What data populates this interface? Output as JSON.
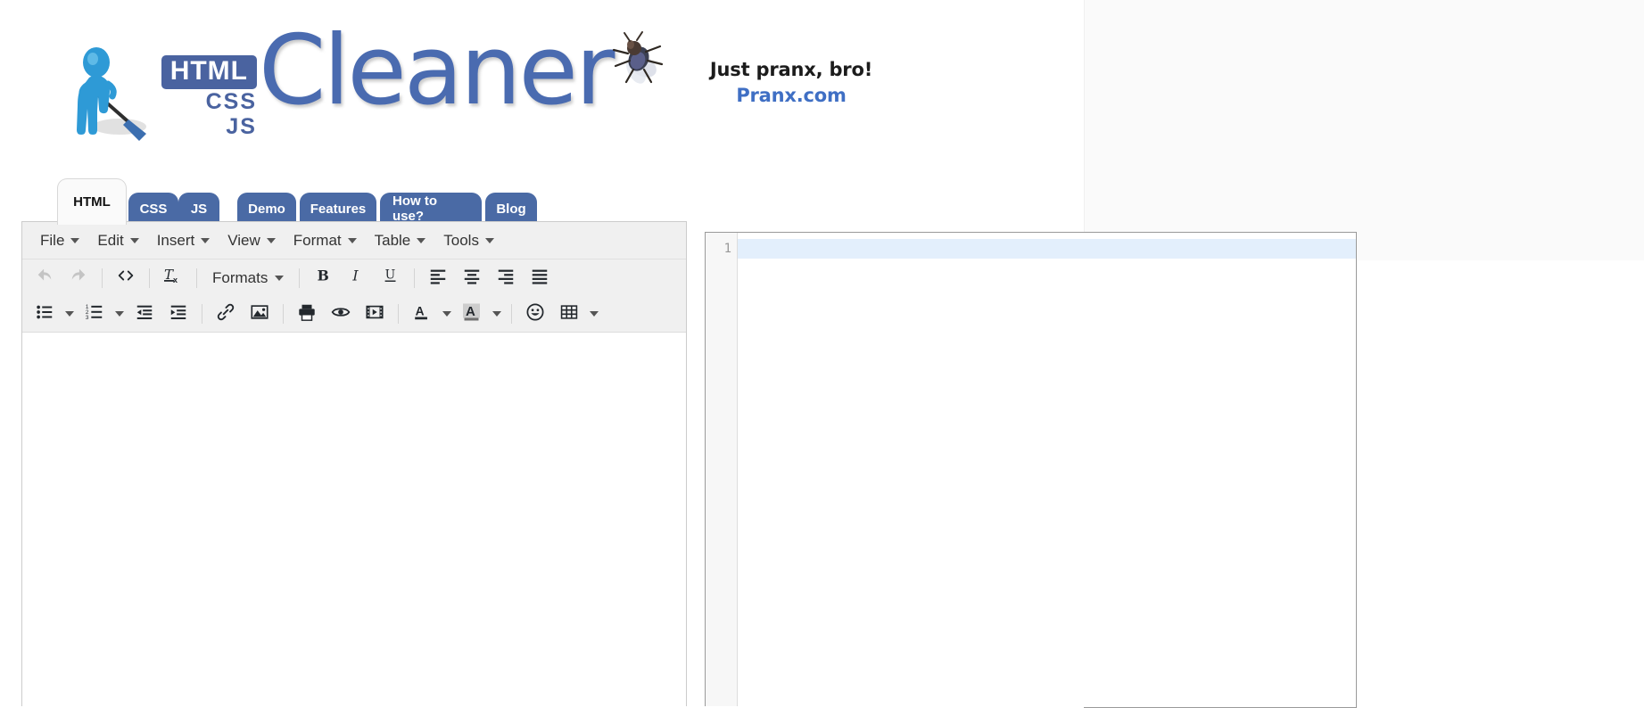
{
  "site": {
    "logo": {
      "html_badge": "HTML",
      "css_label": "CSS",
      "js_label": "JS",
      "wordmark": "Cleaner",
      "mascot_icon": "person-with-broom-icon",
      "brand_color": "#4a63a0",
      "wordmark_color": "#4a6bb0"
    },
    "ad": {
      "icon": "fly-icon",
      "line1": "Just pranx, bro!",
      "line2": "Pranx.com",
      "line1_color": "#1c1c1c",
      "line2_color": "#3f6fc4"
    }
  },
  "tabs": {
    "language_tabs": [
      {
        "label": "HTML",
        "active": true
      },
      {
        "label": "CSS",
        "active": false
      },
      {
        "label": "JS",
        "active": false
      }
    ],
    "nav_tabs": [
      {
        "label": "Demo"
      },
      {
        "label": "Features"
      },
      {
        "label": "How to use?"
      },
      {
        "label": "Blog"
      }
    ],
    "tab_color": "#4a6aa5",
    "active_tab_bg": "#fafafa"
  },
  "editor": {
    "menubar": [
      {
        "label": "File",
        "icon": "chevron-down-icon"
      },
      {
        "label": "Edit",
        "icon": "chevron-down-icon"
      },
      {
        "label": "Insert",
        "icon": "chevron-down-icon"
      },
      {
        "label": "View",
        "icon": "chevron-down-icon"
      },
      {
        "label": "Format",
        "icon": "chevron-down-icon"
      },
      {
        "label": "Table",
        "icon": "chevron-down-icon"
      },
      {
        "label": "Tools",
        "icon": "chevron-down-icon"
      }
    ],
    "toolbar_row1": [
      {
        "name": "undo",
        "icon": "undo-arrow-icon",
        "disabled": true
      },
      {
        "name": "redo",
        "icon": "redo-arrow-icon",
        "disabled": true
      },
      {
        "name": "source-code",
        "icon": "angle-brackets-icon"
      },
      {
        "name": "clear-formatting",
        "icon": "remove-format-icon"
      },
      {
        "name": "formats",
        "label": "Formats",
        "icon": "chevron-down-icon"
      },
      {
        "name": "bold",
        "icon": "bold-icon"
      },
      {
        "name": "italic",
        "icon": "italic-icon"
      },
      {
        "name": "underline",
        "icon": "underline-icon"
      },
      {
        "name": "align-left",
        "icon": "align-left-icon"
      },
      {
        "name": "align-center",
        "icon": "align-center-icon"
      },
      {
        "name": "align-right",
        "icon": "align-right-icon"
      },
      {
        "name": "align-justify",
        "icon": "align-justify-icon"
      }
    ],
    "toolbar_row2": [
      {
        "name": "bullet-list",
        "icon": "bullet-list-icon"
      },
      {
        "name": "numbered-list",
        "icon": "numbered-list-icon"
      },
      {
        "name": "outdent",
        "icon": "outdent-icon"
      },
      {
        "name": "indent",
        "icon": "indent-icon"
      },
      {
        "name": "insert-link",
        "icon": "link-chain-icon"
      },
      {
        "name": "insert-image",
        "icon": "image-icon"
      },
      {
        "name": "print",
        "icon": "printer-icon"
      },
      {
        "name": "preview",
        "icon": "eye-icon"
      },
      {
        "name": "insert-media",
        "icon": "film-strip-icon"
      },
      {
        "name": "text-color",
        "icon": "text-color-a-icon"
      },
      {
        "name": "background-color",
        "icon": "highlight-color-a-icon"
      },
      {
        "name": "emoticons",
        "icon": "smiley-face-icon"
      },
      {
        "name": "insert-table",
        "icon": "table-grid-icon"
      }
    ],
    "content": "",
    "formats_label": "Formats"
  },
  "code_pane": {
    "line_numbers": [
      "1"
    ],
    "lines": [
      ""
    ],
    "active_line": 1,
    "active_line_color": "#e3effc"
  }
}
